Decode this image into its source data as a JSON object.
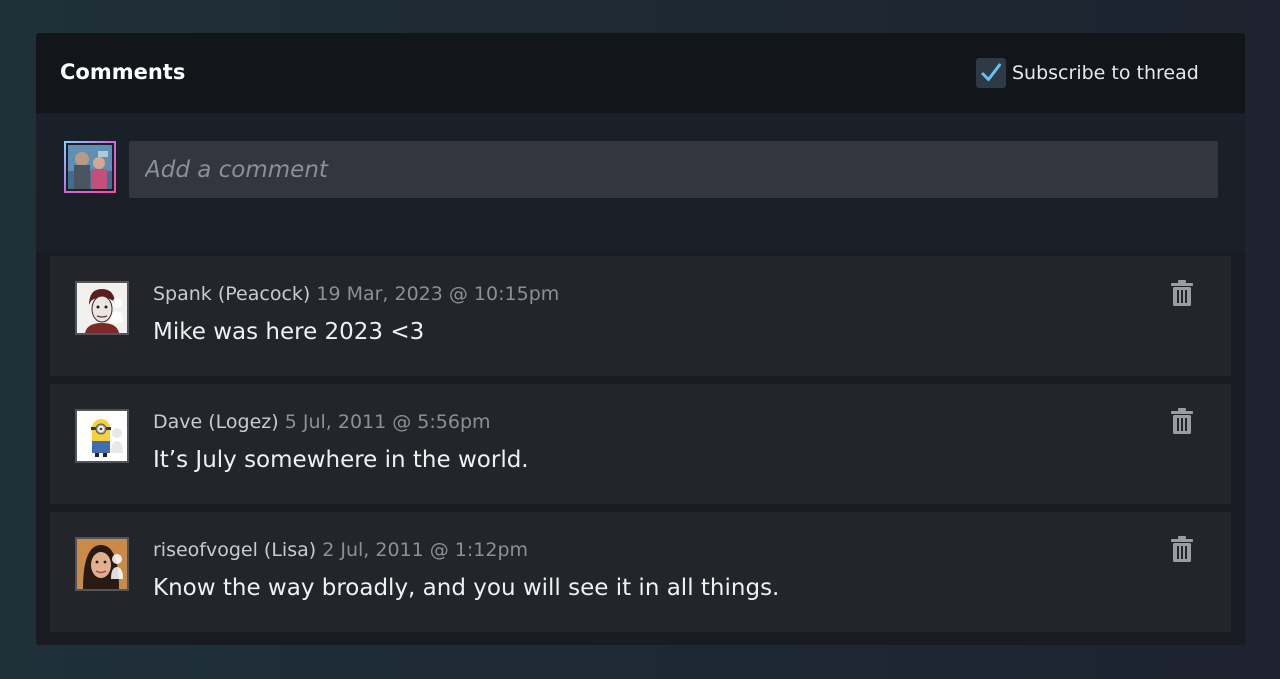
{
  "header": {
    "title": "Comments",
    "subscribe_label": "Subscribe to thread",
    "subscribe_checked": true
  },
  "compose": {
    "placeholder": "Add a comment",
    "avatar_icon": "user-avatar"
  },
  "comments": [
    {
      "author": "Spank (Peacock)",
      "time": "19 Mar, 2023 @ 10:15pm",
      "text": "Mike was here 2023 <3",
      "avatar_icon": "portrait-avatar"
    },
    {
      "author": "Dave (Logez)",
      "time": "5 Jul, 2011 @ 5:56pm",
      "text": "It’s July somewhere in the world.",
      "avatar_icon": "minion-avatar"
    },
    {
      "author": "riseofvogel (Lisa)",
      "time": "2 Jul, 2011 @ 1:12pm",
      "text": "Know the way broadly, and you will see it in all things.",
      "avatar_icon": "photo-avatar"
    }
  ],
  "colors": {
    "panel_bg": "#181c22",
    "header_bg": "#121519",
    "comment_bg": "#23252a",
    "check_color": "#67c1f5"
  }
}
